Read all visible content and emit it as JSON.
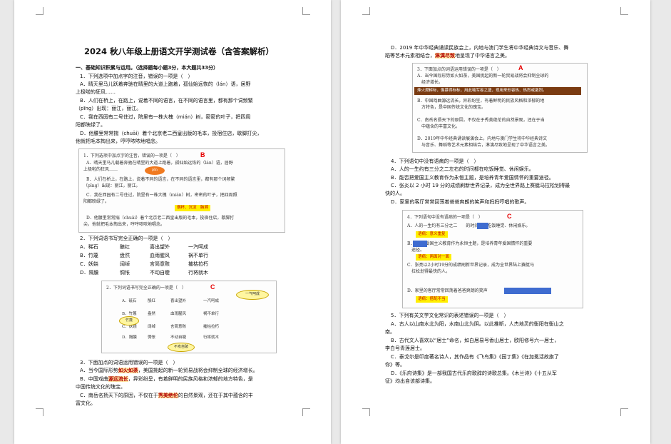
{
  "page1": {
    "title": "2024 秋八年级上册语文开学测试卷（含答案解析）",
    "section1": "一、基础知识积累与运用。（选择题每小题3分，本大题共33分）",
    "q1": {
      "stem": "1．下列选项中加点字的注音，错误的一项是（　）",
      "a1": "A．晴天里马儿跃着奔驰在晴里的大道上跑着，孤仙始远恢的（lán）语，居野",
      "a2": "上极啦的狂风……",
      "b1": "B．人们在桥上，在路上，说着不同的语言，在不同的语言里，都有那个词频繁",
      "b2": "（pīng）出现：丽江，丽江。",
      "c1": "C．我在西园有二号住过，院里有一株大槐（mián）树，密密的叶子，把四周",
      "c2": "阳都映绿了。",
      "d1": "D．他腰里常常揣（chuāi）着个北京老二西皇出版的毛本，投宿住店，歇脚打尖，",
      "d2": "他就把毛本掏出来，哼哼哝哝地唱念。"
    },
    "box1": {
      "label": "1．下列选项中加点字的注音，错误的一项是（　）",
      "answer": "B",
      "a1": "A．晴天里马儿载着奔驰在晴里的大道上跑着，孤仙始远恢的（lán）语，居野",
      "a2": "上极啦的狂风……",
      "callout": "pīn",
      "b1": "B．人们在桥上，在路上，说着不同的语言，在不同的语言里，都有那个词频繁",
      "b2": "（pīng）出现：丽江，丽江。",
      "c1": "C．我在西园有二号住过，院里有一株大槐（mián）树，密密的叶子，把四周照",
      "c2": "阳都映绿了。",
      "note": "烟杯、沉淀　脑溯",
      "d1": "D．他腰里常常揣（chuāi）着个北京老二西皇出版的毛本，投宿住店，歇脚打",
      "d2": "尖，他就把毛本掏出来，哼哼哝哝地唱念。"
    },
    "q2": {
      "stem": "2．下列词语书写完全正确的一项是（　）",
      "rows": [
        [
          "A．稀石",
          "酿红",
          "喜出望外",
          "一汽呵成"
        ],
        [
          "B．竹蔑",
          "盘然",
          "血雨腥风",
          "祸不单行"
        ],
        [
          "C．妖娆",
          "阔绰",
          "言简意赅",
          "摧枯拉朽"
        ],
        [
          "D．隔膜",
          "惆怅",
          "不动自睫",
          "行将就木"
        ]
      ]
    },
    "box2": {
      "label": "2．下列词语书写完全正确的一项是（　）",
      "answer": "C",
      "rows": [
        [
          "A．砥石",
          "殷红",
          "喜出望外",
          "一汽呵成"
        ],
        [
          "B．竹篾",
          "盎然",
          "血雨腥风",
          "祸不单行"
        ],
        [
          "C．妖娆",
          "阔绰",
          "言简意赅",
          "摧枯拉朽"
        ],
        [
          "D．隔膜",
          "惆怅",
          "不动自睫",
          "行将就木"
        ]
      ],
      "callout1": "一气呵成",
      "callout2": "竹篾",
      "callout3": "不攻自破"
    },
    "q3": {
      "stem": "3．下面加点的词语运用错误的一项是（　）",
      "a1_pre": "A．当今国际形势",
      "a1_hl": "如火如荼",
      "a1_post": "，美国挑起的新一轮贸易战将会抑制全球的经济增长。",
      "b1_pre": "B．中国戏曲",
      "b1_hl": "源远流长",
      "b1_post": "，异彩纷呈，有着鲜明的民族风格和浓郁的地方特色，是",
      "b2": "中国传统文化的瑰宝。",
      "c1_pre": "C．南岳名扬天下的原因，不仅在于",
      "c1_hl": "秀美绝伦",
      "c1_post": "的自然景观，还在于其中蕴含的丰",
      "c2": "富文化。"
    }
  },
  "page2": {
    "d1_pre": "D．2019 年中华经典诵读民族会上，内地与澳门学生将中华经典诗文与音乐、舞",
    "d2_pre": "蹈等艺术元素相结合，",
    "d2_hl": "淋漓尽致",
    "d2_post": "地呈现了中华语言之美。",
    "box3": {
      "label": "3．下面加点的词语运用错误的一项是（　）",
      "answer": "A",
      "a1": "A．当今国际形势如火如荼，美国挑起的新一轮贸易战将会抑制全球的",
      "a2": "经济增长。",
      "banner": "烽火燃耕标，像慕得标标，用此喻军容之盛，现用来形容热、热烈或激烈。",
      "b1": "B．中国戏曲源远流长，异彩纷呈，有着鲜明的民族风格和浓郁的地",
      "b2": "方特色，是中国传统文化的瑰宝。",
      "c1": "C．南岳名扬天下的原因，不仅在于秀美绝伦的自然景观，还在于当",
      "c2": "中蕴含的丰富文化。",
      "d1": "D．2019年中华经典诵读展演会上，内地与澳门学生将中华经典诗文",
      "d2": "与音乐、舞蹈等艺术元素相结合，淋漓尽致地呈现了中华语言之美。"
    },
    "q4": {
      "stem": "4．下列语句中没有语病的一项是（　）",
      "a": "A．人的一生约有三分之二左右的时间都在吃饭睡觉、休闲娱乐。",
      "b": "B．能否把爱国主义教育作为永恒主题，是培养青年爱国情怀的重要途径。",
      "c1": "C．张炎以 2 小时 19 分的成绩刷新世界记录，成为全世界路上赛艇马拉松划得最",
      "c2": "快的人。",
      "d": "D．家里的客厅常常回荡着爸爸爽朗的笑声和妈妈哼唱的歌声。"
    },
    "box4": {
      "label": "4．下列语句中没有语病的一项是（　）",
      "answer": "C",
      "a": "A．人的一生约有三分之二　　的时间都在吃饭睡觉、休闲娱乐。",
      "note_a": "语病：意义重复",
      "b1": "B．　　把爱国主义教育作为永恒主题，是培养青年爱国情怀的重要",
      "b2": "途径。",
      "note_b": "语病：两面对一面",
      "c1": "C．张亮以2小时19分的成绩刷新世界记录，成为全世界陆上赛艇马",
      "c2": "拉松划得最快的人。",
      "d": "D．家里的客厅常常回荡着爸爸爽朗的笑声",
      "note_d": "语病：搭配不当"
    },
    "q5": {
      "stem": "5．下列有关文学文化常识的表述错误的一项是（　）",
      "a1": "A．古人以山南水北为阳，水南山北为阴。以此推断，人杰地灵的衡阳在衡山之",
      "a2": "南。",
      "b1": "B．古代文人喜欢以“居士”命名，如白居易号香山居士，欧阳修号六一居士，",
      "b2": "李白号青莲居士。",
      "c1": "C．泰戈尔是印度著名诗人，其作品有《飞鸟集》《园丁集》《在加冕活故旗了",
      "c2": "你》等。",
      "d1": "D．《乐府诗集》是一部我国古代乐府歌辞的诗歌总集。《木兰诗》《十五从军",
      "d2": "征》均出自该部诗集。"
    }
  },
  "colors": {
    "answer_red": "#e60000",
    "highlight_yellow": "#ffef00",
    "blue_mask": "#3f6cd0",
    "banner_brown": "#7a3b12"
  },
  "icons": {
    "drag": "drag-handle-icon"
  }
}
